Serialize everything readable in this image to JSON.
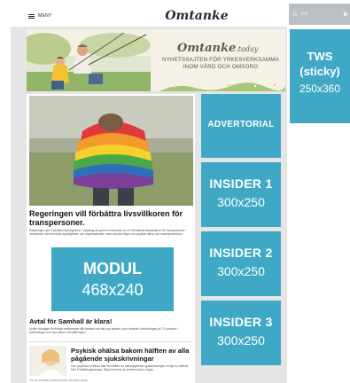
{
  "header": {
    "menu_label": "MENY",
    "logo": "Omtanke"
  },
  "search": {
    "placeholder": "Sök"
  },
  "banner": {
    "logo": "Omtanke",
    "logo_suffix": ".today",
    "tagline_line1": "NYHETSSAJTEN FÖR YRKESVERKSAMMA",
    "tagline_line2": "INOM VÅRD OCH OMSORG"
  },
  "articles": {
    "main": {
      "headline": "Regeringen vill förbättra livsvillkoren för transpersoner.",
      "lead": "Regeringen ger Folkhälsomyndigheten i uppdrag att göra en förstudie om en förbättrad livssituation för transpersoner i samarbete med berörda myndigheter och organisationer, samt utreda frågor om psykisk hälsa och suicidprevention."
    },
    "second": {
      "headline": "Avtal för Samhall är klara!",
      "lead": "Under lördagen förenade medlemmar fått besked om det nya avtalet, som innebär löneökningar på 7,5 procent i förändringar och nya villkor i anställningen."
    },
    "third": {
      "headline": "Psykisk ohälsa bakom hälften av alla pågående sjukskrivningar",
      "lead": "Den psykiska ohälsan står för hälften av alla pågående sjukskrivningar, enligt ny statistik från Försäkringskassan. Bland kvinnor är andelen ännu högre."
    },
    "footnote": "Läs de senaste nyheterna från Omtanke.today"
  },
  "ads": {
    "modul": {
      "title": "MODUL",
      "size": "468x240"
    },
    "advertorial": {
      "label": "ADVERTORIAL"
    },
    "insider1": {
      "title": "INSIDER 1",
      "size": "300x250"
    },
    "insider2": {
      "title": "INSIDER 2",
      "size": "300x250"
    },
    "insider3": {
      "title": "INSIDER 3",
      "size": "300x250"
    },
    "tws": {
      "title": "TWS",
      "sticky": "(sticky)",
      "size": "250x360"
    }
  },
  "colors": {
    "ad_blue": "#3fa9c5",
    "search_bg": "#b8c0c6",
    "frame_gray": "#e5e5e5",
    "banner_bg": "#f5f1e6"
  },
  "icons": [
    "hamburger-menu-icon",
    "search-icon",
    "search-submit-arrow-icon"
  ]
}
